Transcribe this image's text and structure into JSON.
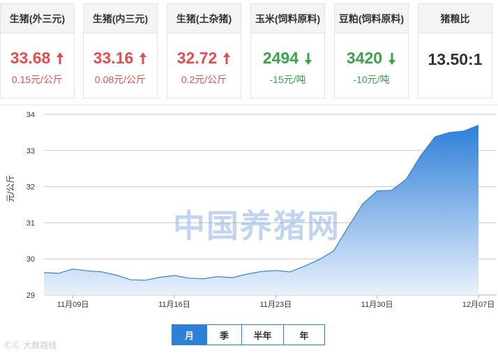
{
  "cards": [
    {
      "title": "生猪(外三元)",
      "value": "33.68",
      "change": "0.15元/公斤",
      "trend": "up"
    },
    {
      "title": "生猪(内三元)",
      "value": "33.16",
      "change": "0.08元/公斤",
      "trend": "up"
    },
    {
      "title": "生猪(土杂猪)",
      "value": "32.72",
      "change": "0.2元/公斤",
      "trend": "up"
    },
    {
      "title": "玉米(饲料原料)",
      "value": "2494",
      "change": "-15元/吨",
      "trend": "down"
    },
    {
      "title": "豆粕(饲料原料)",
      "value": "3420",
      "change": "-10元/吨",
      "trend": "down"
    },
    {
      "title": "猪粮比",
      "value": "13.50:1",
      "change": "",
      "trend": "none"
    }
  ],
  "chart_data": {
    "type": "area",
    "title": "",
    "xlabel": "",
    "ylabel": "元/公斤",
    "ylim": [
      29,
      34
    ],
    "yticks": [
      29,
      30,
      31,
      32,
      33,
      34
    ],
    "xtick_labels": [
      "11月09日",
      "11月16日",
      "11月23日",
      "11月30日",
      "12月07日"
    ],
    "x": [
      "11月07日",
      "11月08日",
      "11月09日",
      "11月10日",
      "11月11日",
      "11月12日",
      "11月13日",
      "11月14日",
      "11月15日",
      "11月16日",
      "11月17日",
      "11月18日",
      "11月19日",
      "11月20日",
      "11月21日",
      "11月22日",
      "11月23日",
      "11月24日",
      "11月25日",
      "11月26日",
      "11月27日",
      "11月28日",
      "11月29日",
      "11月30日",
      "12月01日",
      "12月02日",
      "12月03日",
      "12月04日",
      "12月05日",
      "12月06日",
      "12月07日"
    ],
    "series": [
      {
        "values": [
          29.62,
          29.6,
          29.72,
          29.67,
          29.64,
          29.55,
          29.42,
          29.41,
          29.49,
          29.54,
          29.47,
          29.45,
          29.51,
          29.48,
          29.58,
          29.65,
          29.68,
          29.64,
          29.8,
          29.98,
          30.22,
          30.88,
          31.52,
          31.88,
          31.9,
          32.2,
          32.85,
          33.38,
          33.5,
          33.54,
          33.7
        ]
      }
    ],
    "grid": true,
    "fill_gradient": [
      "#2e7fd8",
      "#e9f1fb"
    ]
  },
  "watermark": "中国养猪网",
  "range_tabs": [
    {
      "label": "月",
      "active": true
    },
    {
      "label": "季",
      "active": false
    },
    {
      "label": "半年",
      "active": false
    },
    {
      "label": "年",
      "active": false
    }
  ],
  "corner_logo": "ⒸⒸ 大数路线"
}
